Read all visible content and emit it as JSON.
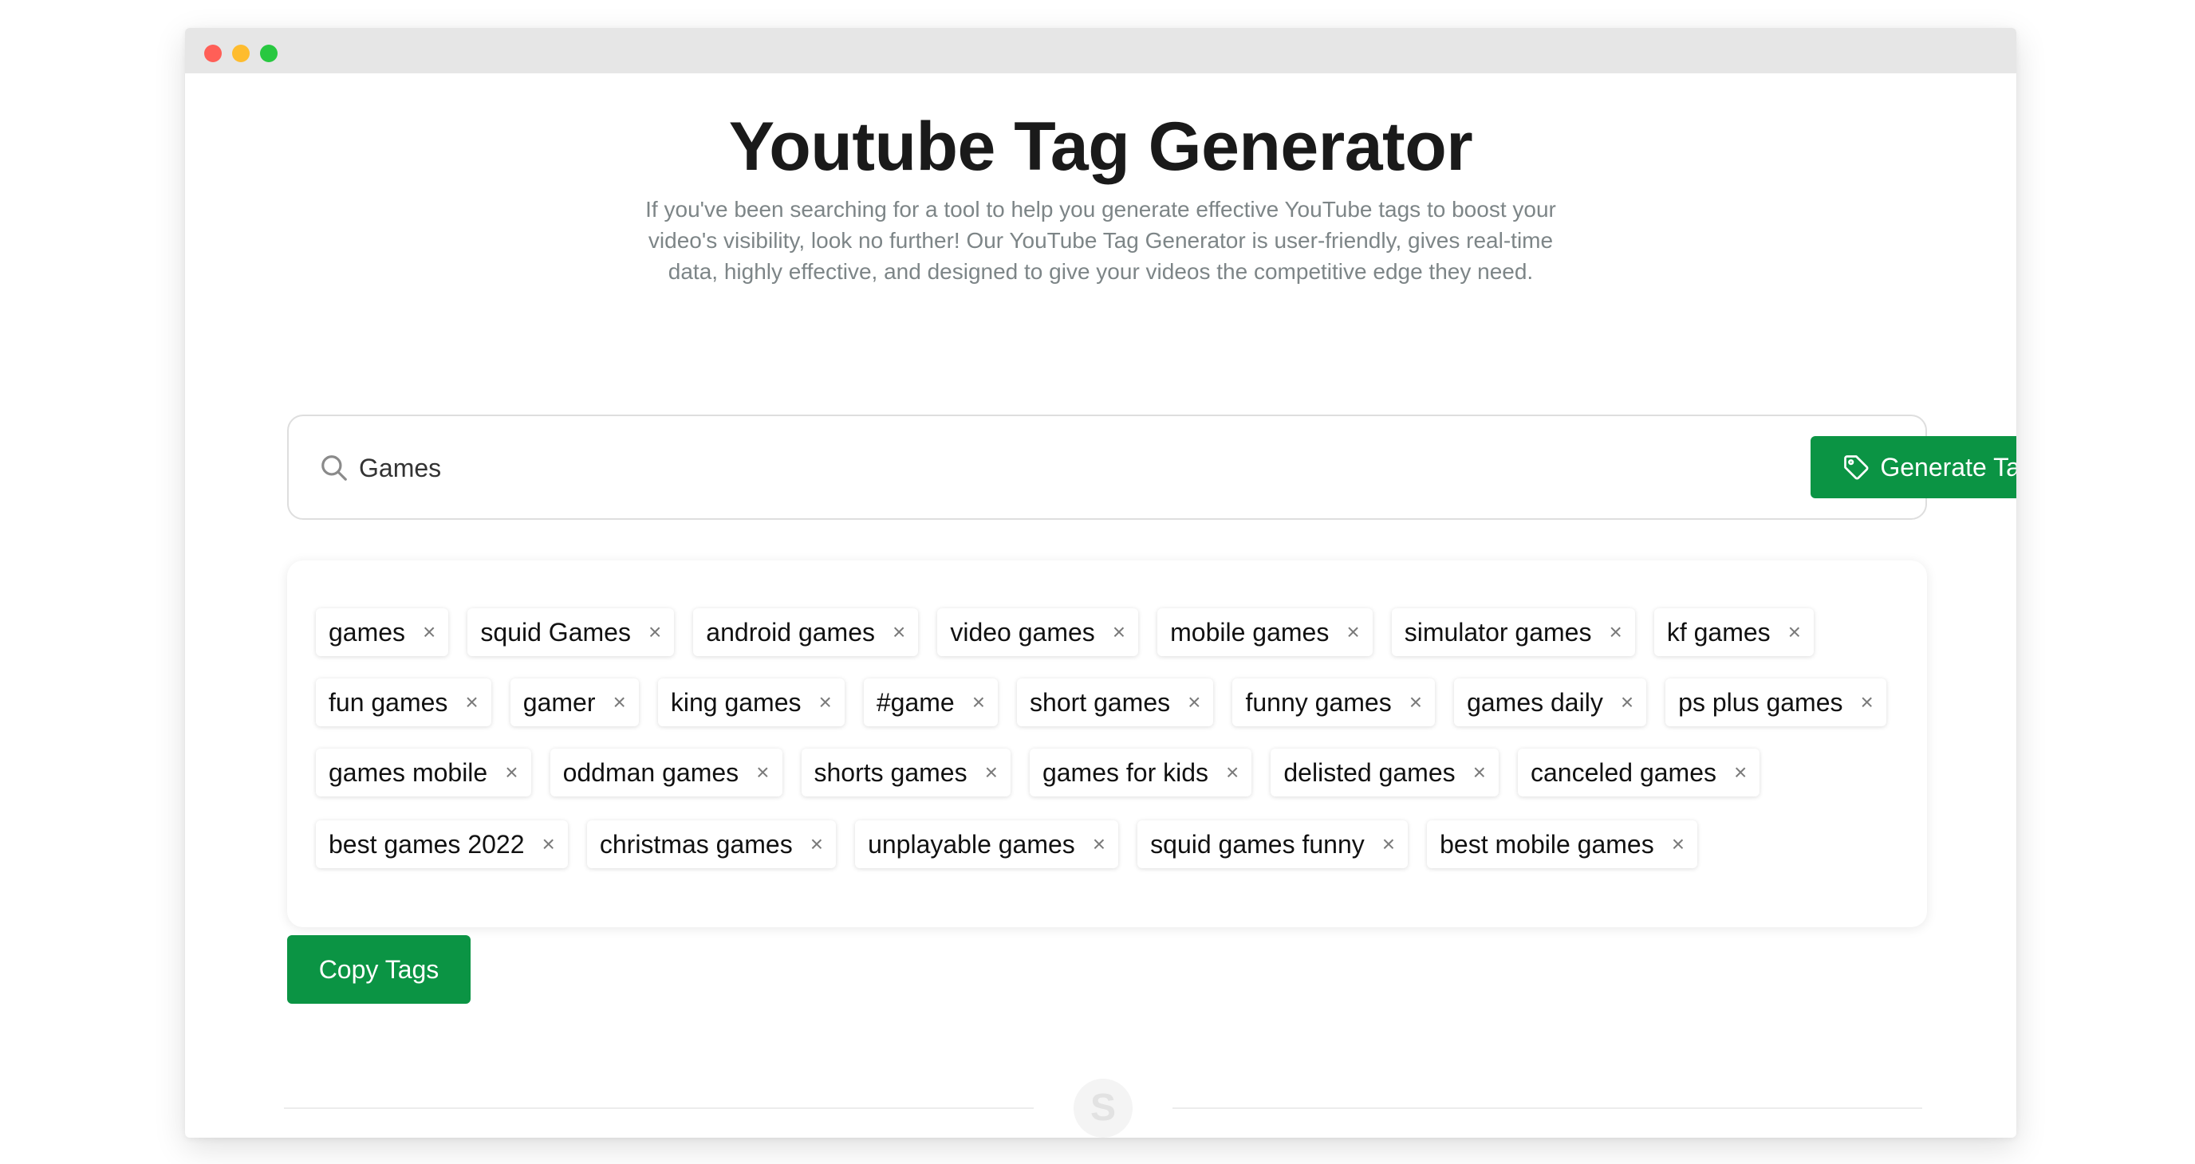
{
  "page": {
    "title": "Youtube Tag Generator",
    "intro": "If you've been searching for a tool to help you generate effective YouTube tags to boost your video's visibility, look no further! Our YouTube Tag Generator is user-friendly, gives real-time data, highly effective, and designed to give your videos the competitive edge they need."
  },
  "search": {
    "value": "Games",
    "icon": "search-icon",
    "button_label": "Generate Tags",
    "button_icon": "tag-icon"
  },
  "tags": {
    "close_glyph": "×",
    "rows": [
      [
        "games",
        "squid Games",
        "android games",
        "video games",
        "mobile games",
        "simulator games",
        "kf games"
      ],
      [
        "fun games",
        "gamer",
        "king games",
        "#game",
        "short games",
        "funny games",
        "games daily",
        "ps plus games"
      ],
      [
        "games mobile",
        "oddman games",
        "shorts games",
        "games for kids",
        "delisted games",
        "canceled games"
      ],
      [
        "best games 2022",
        "christmas games",
        "unplayable games",
        "squid games funny",
        "best mobile games"
      ]
    ]
  },
  "actions": {
    "copy_label": "Copy Tags"
  },
  "footer": {
    "logo_letter": "S"
  },
  "colors": {
    "accent": "#0b9444",
    "text_muted": "#7d8587"
  }
}
